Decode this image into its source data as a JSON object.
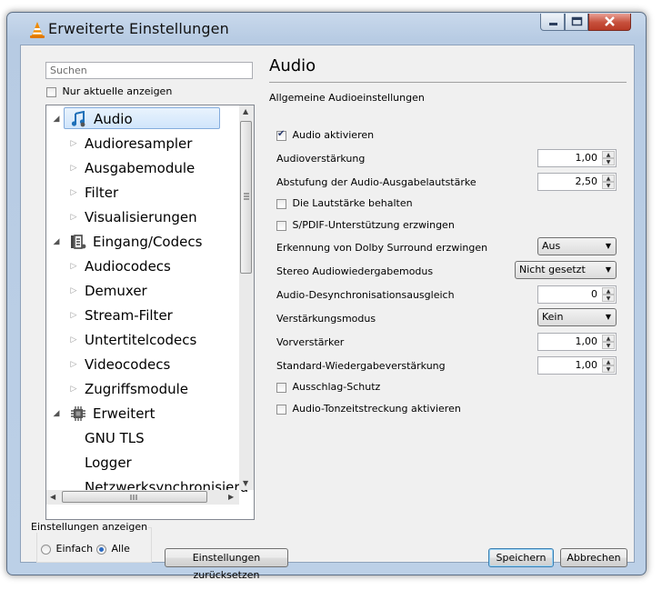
{
  "window": {
    "title": "Erweiterte Einstellungen"
  },
  "left": {
    "search_placeholder": "Suchen",
    "only_current_label": "Nur aktuelle anzeigen",
    "only_current_checked": false,
    "tree": [
      {
        "label": "Audio",
        "level": 0,
        "icon": "audio-note-icon",
        "selected": true
      },
      {
        "label": "Audioresampler",
        "level": 1
      },
      {
        "label": "Ausgabemodule",
        "level": 1
      },
      {
        "label": "Filter",
        "level": 1
      },
      {
        "label": "Visualisierungen",
        "level": 1
      },
      {
        "label": "Eingang/Codecs",
        "level": 0,
        "icon": "input-codecs-icon"
      },
      {
        "label": "Audiocodecs",
        "level": 1
      },
      {
        "label": "Demuxer",
        "level": 1
      },
      {
        "label": "Stream-Filter",
        "level": 1
      },
      {
        "label": "Untertitelcodecs",
        "level": 1
      },
      {
        "label": "Videocodecs",
        "level": 1
      },
      {
        "label": "Zugriffsmodule",
        "level": 1
      },
      {
        "label": "Erweitert",
        "level": 0,
        "icon": "gear-chip-icon"
      },
      {
        "label": "GNU TLS",
        "level": 1,
        "leaf": true
      },
      {
        "label": "Logger",
        "level": 1,
        "leaf": true
      },
      {
        "label": "Netzwerksynchronisieru",
        "level": 1,
        "leaf": true
      }
    ]
  },
  "main": {
    "heading": "Audio",
    "subheading": "Allgemeine Audioeinstellungen",
    "audio_enable": {
      "label": "Audio aktivieren",
      "checked": true
    },
    "gain": {
      "label": "Audioverstärkung",
      "value": "1,00"
    },
    "volume_step": {
      "label": "Abstufung der Audio-Ausgabelautstärke",
      "value": "2,50"
    },
    "keep_volume": {
      "label": "Die Lautstärke behalten",
      "checked": false
    },
    "spdif": {
      "label": "S/PDIF-Unterstützung erzwingen",
      "checked": false
    },
    "dolby": {
      "label": "Erkennung von Dolby Surround erzwingen",
      "value": "Aus"
    },
    "stereo_mode": {
      "label": "Stereo Audiowiedergabemodus",
      "value": "Nicht gesetzt"
    },
    "desync": {
      "label": "Audio-Desynchronisationsausgleich",
      "value": "0"
    },
    "gain_mode": {
      "label": "Verstärkungsmodus",
      "value": "Kein"
    },
    "preamp": {
      "label": "Vorverstärker",
      "value": "1,00"
    },
    "default_gain": {
      "label": "Standard-Wiedergabeverstärkung",
      "value": "1,00"
    },
    "spike": {
      "label": "Ausschlag-Schutz",
      "checked": false
    },
    "timestretch": {
      "label": "Audio-Tonzeitstreckung aktivieren",
      "checked": false
    }
  },
  "footer": {
    "show_settings_label": "Einstellungen anzeigen",
    "simple_label": "Einfach",
    "all_label": "Alle",
    "selected": "Alle",
    "reset_button": "Einstellungen zurücksetzen",
    "save_button": "Speichern",
    "cancel_button": "Abbrechen"
  }
}
